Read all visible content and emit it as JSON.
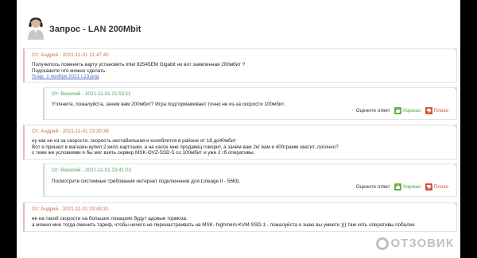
{
  "header": {
    "title": "Запрос - LAN 200Mbit"
  },
  "messages": [
    {
      "author_line": "От: Андрей - 2021-11-01 21:47:40",
      "lines": [
        "Получилось поменять карту установить Intel 82545EM Gigabit но вот заявленная 200мбит ?",
        "Подскажите что можно сделать"
      ],
      "attachment": "Snap_1 ноября 2021 г.23.png"
    },
    {
      "author_line": "От: Василий - 2021-11-01 21:53:11",
      "lines": [
        "Уточните, пожалуйста, зачем вам 200мбит? Игра подтормаживает точно не из-за скорости 100мбит."
      ]
    },
    {
      "author_line": "От: Андрей - 2021-11-01 23:30:38",
      "lines": [
        "ну как не из за скорости. скорость нестабильная и колеблется в районе от 18 до40мбит",
        "Вот я пришел в магазин купил 2 кило картошки, а на кассе мне продавец говорит, а зачем вам 2кг вам и 400грамм хватит..логично?",
        "с теже же условиями я бы мог взять сервер MSK-OVZ-SSD-5 со 100мбит и уже 2 гб оперативы."
      ]
    },
    {
      "author_line": "От: Василий - 2021-11-01 23:41:03",
      "lines": [
        "Посмотрите системные требования интернет подключения для Lineage II - 56Kb."
      ]
    },
    {
      "author_line": "От: Андрей - 2021-11-01 23:43:31",
      "lines": [
        "не на такой скорости на больших локациях будут адовые тормоза.",
        "а можно мне тогда сменить тариф, чтобы ничего не перенастраивать на MSK- highmem-KVM-SSD-1 - пожалуйста я знаю вы умеете ))) там хоть оперативы побалее"
      ]
    }
  ],
  "rating": {
    "label": "Оцените ответ",
    "good": "Хорошо",
    "bad": "Плохо"
  },
  "logo": {
    "text": "ОТЗОВИК"
  },
  "colors": {
    "question_accent": "#d06a4d",
    "reply_accent": "#4f9c5a",
    "good": "#60b246",
    "bad": "#d4513d"
  }
}
